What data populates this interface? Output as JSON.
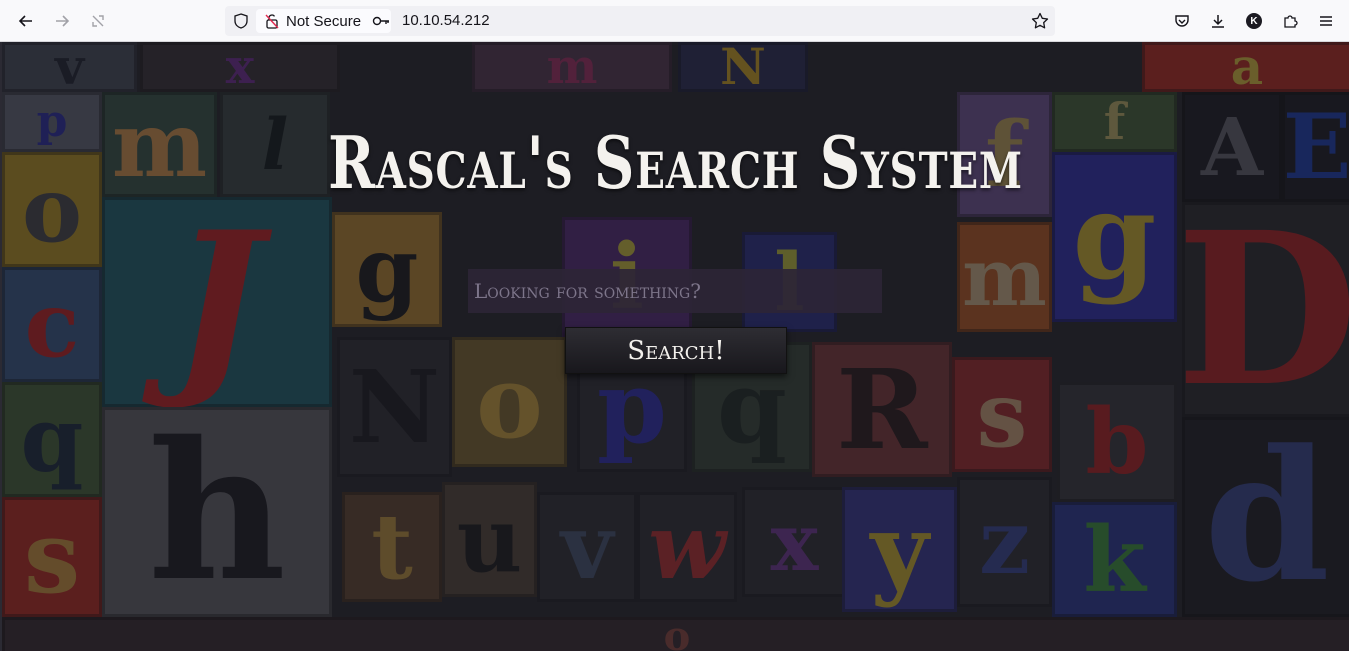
{
  "browser": {
    "security_label": "Not Secure",
    "url": "10.10.54.212",
    "account_initial": "K"
  },
  "page": {
    "title": "Rascal's Search System",
    "search_placeholder": "Looking for something?",
    "search_button": "Search!"
  },
  "background_letters": [
    "v",
    "x",
    "m",
    "N",
    "a",
    "p",
    "m",
    "l",
    "o",
    "f",
    "f",
    "A",
    "E",
    "o",
    "J",
    "g",
    "i",
    "l",
    "m",
    "c",
    "g",
    "D",
    "N",
    "o",
    "p",
    "q",
    "R",
    "s",
    "q",
    "b",
    "h",
    "s",
    "t",
    "u",
    "v",
    "w",
    "x",
    "y",
    "z",
    "k",
    "d"
  ],
  "colors": {
    "toolbar": "#f9f9fb",
    "page_overlay": "#18181e",
    "title_text": "#f4f2ee",
    "input_bg": "#2c2536"
  }
}
